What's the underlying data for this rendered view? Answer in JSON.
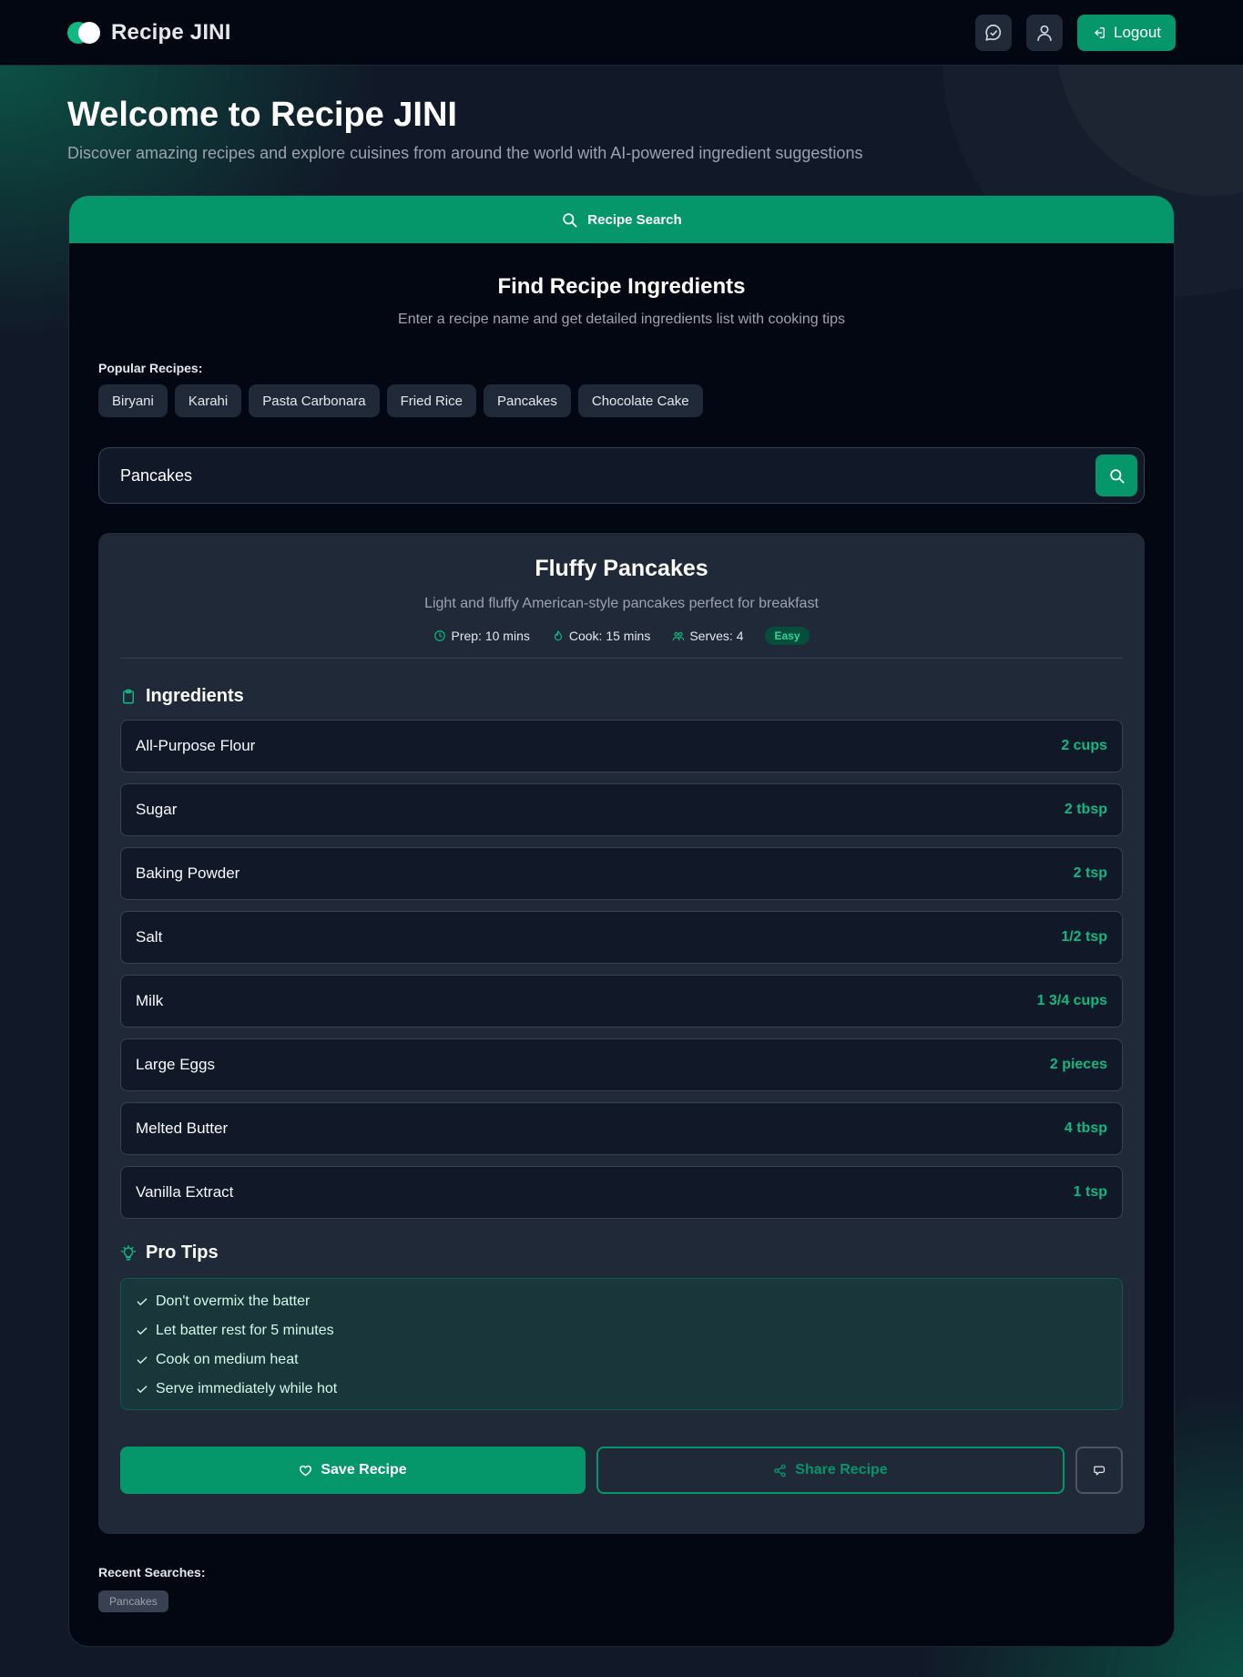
{
  "app": {
    "name": "Recipe JINI"
  },
  "header": {
    "logout_label": "Logout",
    "icons": [
      "chat-icon",
      "user-icon",
      "logout-icon"
    ]
  },
  "hero": {
    "title": "Welcome to Recipe JINI",
    "subtitle": "Discover amazing recipes and explore cuisines from around the world with AI-powered ingredient suggestions"
  },
  "tab": {
    "label": "Recipe Search"
  },
  "finder": {
    "title": "Find Recipe Ingredients",
    "subtitle": "Enter a recipe name and get detailed ingredients list with cooking tips",
    "popular_label": "Popular Recipes:",
    "popular": [
      "Biryani",
      "Karahi",
      "Pasta Carbonara",
      "Fried Rice",
      "Pancakes",
      "Chocolate Cake"
    ],
    "search_value": "Pancakes"
  },
  "recipe": {
    "title": "Fluffy Pancakes",
    "description": "Light and fluffy American-style pancakes perfect for breakfast",
    "prep": "Prep: 10 mins",
    "cook": "Cook: 15 mins",
    "serves": "Serves: 4",
    "difficulty": "Easy",
    "ingredients_label": "Ingredients",
    "ingredients": [
      {
        "name": "All-Purpose Flour",
        "qty": "2 cups"
      },
      {
        "name": "Sugar",
        "qty": "2 tbsp"
      },
      {
        "name": "Baking Powder",
        "qty": "2 tsp"
      },
      {
        "name": "Salt",
        "qty": "1/2 tsp"
      },
      {
        "name": "Milk",
        "qty": "1 3/4 cups"
      },
      {
        "name": "Large Eggs",
        "qty": "2 pieces"
      },
      {
        "name": "Melted Butter",
        "qty": "4 tbsp"
      },
      {
        "name": "Vanilla Extract",
        "qty": "1 tsp"
      }
    ],
    "tips_label": "Pro Tips",
    "tips": [
      "Don't overmix the batter",
      "Let batter rest for 5 minutes",
      "Cook on medium heat",
      "Serve immediately while hot"
    ],
    "save_label": "Save Recipe",
    "share_label": "Share Recipe"
  },
  "recent": {
    "label": "Recent Searches:",
    "items": [
      "Pancakes"
    ]
  },
  "colors": {
    "accent": "#059669",
    "accent_text": "#10b981",
    "background": "#111827",
    "panel": "#1f2937"
  }
}
